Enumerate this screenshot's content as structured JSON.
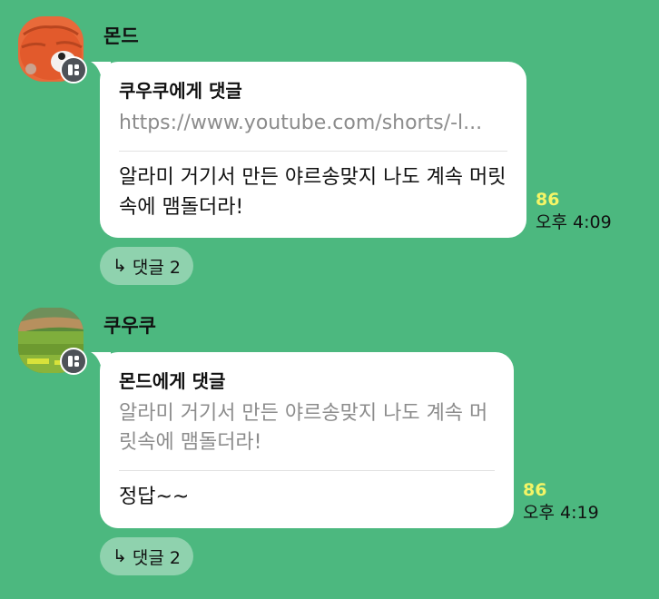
{
  "messages": [
    {
      "sender": "몬드",
      "avatar": "orange-plush-character",
      "reply_to": "쿠우쿠에게 댓글",
      "quoted_link": "https://www.youtube.com/shorts/-l...",
      "text": "알라미 거기서 만든 야르송맞지 나도 계속 머릿속에 맴돌더라!",
      "unread_count": "86",
      "time": "오후 4:09",
      "thread_arrow": "↳",
      "thread_label": "댓글 2"
    },
    {
      "sender": "쿠우쿠",
      "avatar": "baseball-field-photo",
      "reply_to": "몬드에게 댓글",
      "quoted_text": "알라미 거기서 만든 야르송맞지 나도 계속 머릿속에 맴돌더라!",
      "text": "정답~~",
      "unread_count": "86",
      "time": "오후 4:19",
      "thread_arrow": "↳",
      "thread_label": "댓글 2"
    }
  ],
  "colors": {
    "background": "#4cb87f",
    "bubble": "#ffffff",
    "unread": "#f5f566",
    "thread_pill": "#8fd2ae",
    "quote_text": "#8c8c8c"
  }
}
